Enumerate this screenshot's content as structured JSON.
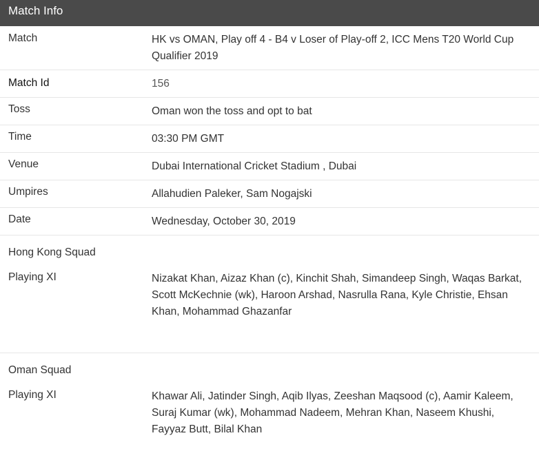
{
  "header": {
    "title": "Match Info"
  },
  "rows": {
    "match": {
      "label": "Match",
      "value": "HK vs OMAN, Play off 4 - B4 v Loser of Play-off 2, ICC Mens T20 World Cup Qualifier 2019"
    },
    "match_id": {
      "label": "Match Id",
      "value": "156"
    },
    "toss": {
      "label": "Toss",
      "value": "Oman won the toss and opt to bat"
    },
    "time": {
      "label": "Time",
      "value": "03:30 PM GMT"
    },
    "venue": {
      "label": "Venue",
      "value": "Dubai International Cricket Stadium , Dubai"
    },
    "umpires": {
      "label": "Umpires",
      "value": "Allahudien Paleker, Sam Nogajski"
    },
    "date": {
      "label": "Date",
      "value": "Wednesday, October 30, 2019"
    }
  },
  "squads": {
    "hong_kong": {
      "title": "Hong Kong Squad",
      "label": "Playing XI",
      "players": "Nizakat Khan, Aizaz Khan (c), Kinchit Shah, Simandeep Singh, Waqas Barkat, Scott McKechnie (wk), Haroon Arshad, Nasrulla Rana, Kyle Christie, Ehsan Khan, Mohammad Ghazanfar"
    },
    "oman": {
      "title": "Oman Squad",
      "label": "Playing XI",
      "players": "Khawar Ali, Jatinder Singh, Aqib Ilyas, Zeeshan Maqsood (c), Aamir Kaleem, Suraj Kumar (wk), Mohammad Nadeem, Mehran Khan, Naseem Khushi, Fayyaz Butt, Bilal Khan"
    }
  }
}
